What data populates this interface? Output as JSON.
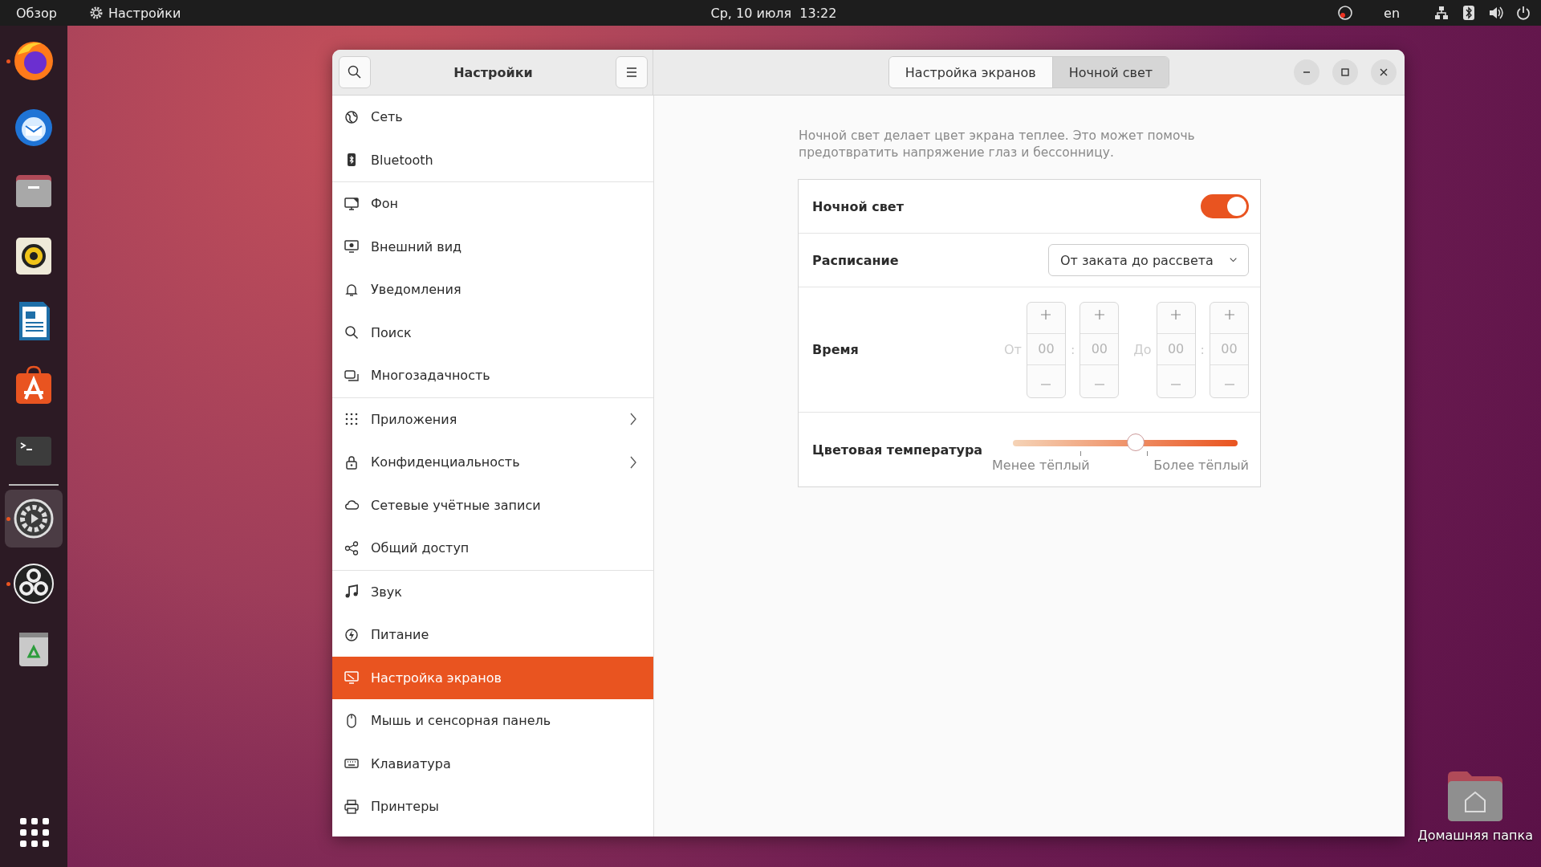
{
  "top_bar": {
    "activities": "Обзор",
    "app_menu": "Настройки",
    "clock": "Ср, 10 июля  13:22",
    "language": "en"
  },
  "dock": [
    {
      "running": true,
      "selected": false
    },
    {
      "running": false,
      "selected": false
    },
    {
      "running": false,
      "selected": false
    },
    {
      "running": false,
      "selected": false
    },
    {
      "running": false,
      "selected": false
    },
    {
      "running": false,
      "selected": false
    },
    {
      "running": false,
      "selected": false
    },
    {
      "running": true,
      "selected": true
    },
    {
      "running": true,
      "selected": false
    },
    {
      "running": false,
      "selected": false
    }
  ],
  "window": {
    "title": "Настройки",
    "tabs": [
      {
        "label": "Настройка экранов",
        "selected": false
      },
      {
        "label": "Ночной свет",
        "selected": true
      }
    ],
    "sidebar": {
      "groups": [
        [
          {
            "label": "Сеть",
            "selected": false
          },
          {
            "label": "Bluetooth",
            "selected": false
          }
        ],
        [
          {
            "label": "Фон",
            "selected": false
          },
          {
            "label": "Внешний вид",
            "selected": false
          },
          {
            "label": "Уведомления",
            "selected": false
          },
          {
            "label": "Поиск",
            "selected": false
          },
          {
            "label": "Многозадачность",
            "selected": false
          }
        ],
        [
          {
            "label": "Приложения",
            "selected": false,
            "chevron": true
          },
          {
            "label": "Конфиденциальность",
            "selected": false,
            "chevron": true
          },
          {
            "label": "Сетевые учётные записи",
            "selected": false
          },
          {
            "label": "Общий доступ",
            "selected": false
          }
        ],
        [
          {
            "label": "Звук",
            "selected": false
          },
          {
            "label": "Питание",
            "selected": false
          },
          {
            "label": "Настройка экранов",
            "selected": true
          },
          {
            "label": "Мышь и сенсорная панель",
            "selected": false
          },
          {
            "label": "Клавиатура",
            "selected": false
          },
          {
            "label": "Принтеры",
            "selected": false
          }
        ]
      ]
    },
    "panel": {
      "description": "Ночной свет делает цвет экрана теплее. Это может помочь предотвратить напряжение глаз и бессонницу.",
      "night_light": {
        "label": "Ночной свет",
        "on": true
      },
      "schedule": {
        "label": "Расписание",
        "value": "От заката до рассвета"
      },
      "time": {
        "label": "Время",
        "disabled": true,
        "from_label": "От",
        "to_label": "До",
        "separator": ":",
        "from": [
          "00",
          "00"
        ],
        "to": [
          "00",
          "00"
        ]
      },
      "temperature": {
        "label": "Цветовая температура",
        "level": 0.55,
        "min_label": "Менее тёплый",
        "max_label": "Более тёплый"
      }
    }
  },
  "desktop_icon": {
    "label": "Домашняя папка"
  }
}
